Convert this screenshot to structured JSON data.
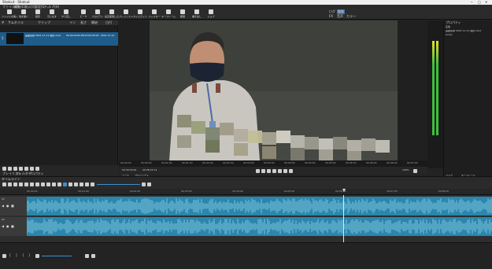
{
  "window": {
    "title": "Shotcut - Shotcut"
  },
  "menu": [
    "ファイル(F)",
    "編集(E)",
    "表示(V)",
    "設定(S)",
    "ヘルプ(H)"
  ],
  "toolbar": [
    {
      "label": "ファイルを開く",
      "icon": "open-folder-icon"
    },
    {
      "label": "他を開く",
      "icon": "open-other-icon"
    },
    {
      "label": "保存",
      "icon": "save-icon"
    },
    {
      "label": "元に戻す",
      "icon": "undo-icon"
    },
    {
      "label": "やり直し",
      "icon": "redo-icon"
    },
    {
      "label": "ピーク",
      "icon": "peak-meter-icon"
    },
    {
      "label": "プロパティ",
      "icon": "properties-icon"
    },
    {
      "label": "最近使用した",
      "icon": "recent-icon"
    },
    {
      "label": "プレイリスト",
      "icon": "playlist-icon"
    },
    {
      "label": "タイムライン",
      "icon": "timeline-icon"
    },
    {
      "label": "フィルター",
      "icon": "filter-icon"
    },
    {
      "label": "キーフレーム",
      "icon": "keyframe-icon"
    },
    {
      "label": "履歴",
      "icon": "history-icon"
    },
    {
      "label": "書き出し",
      "icon": "export-icon"
    },
    {
      "label": "ジョブ",
      "icon": "jobs-icon"
    }
  ],
  "layout_switcher": {
    "items": [
      "ログ",
      "編集",
      "FX",
      "音声",
      "カラー"
    ]
  },
  "playlist": {
    "columns": [
      "#",
      "サムネイル",
      "クリップ",
      "イン",
      "長さ",
      "開始",
      "日付"
    ],
    "row": {
      "index": "1",
      "clip": "画面収録 2021-11-11 撮影.mp4",
      "in": "00:00:00",
      "duration": "00:08:25",
      "start": "00:00:00",
      "date": "2021-11-11"
    },
    "tabs": [
      "プレイリスト",
      "フィルター",
      "プロパティ"
    ]
  },
  "viewer": {
    "timecode": "00:00:00:00",
    "duration": "00:08:25:14",
    "ruler": [
      "00:00:00",
      "00:00:30",
      "00:01:00",
      "00:01:30",
      "00:02:00",
      "00:02:30",
      "00:03:00",
      "00:03:30",
      "00:04:00",
      "00:04:30",
      "00:05:00",
      "00:05:30",
      "00:06:00",
      "00:06:30",
      "00:07:00"
    ],
    "tabs": [
      "ソース",
      "プロジェクト"
    ],
    "zoom": "100%"
  },
  "properties": {
    "title": "プロパティ",
    "lines": [
      "名前",
      "画面収録 2021-11-11 撮影.mp4",
      "Audio"
    ],
    "tabs": [
      "ジョブ",
      "キーフレーム"
    ]
  },
  "timeline": {
    "tabs": [
      "タイムライン"
    ],
    "ruler": [
      "00:00:00",
      "00:01:00",
      "00:02:00",
      "00:03:00",
      "00:04:00",
      "00:05:00",
      "00:06:00",
      "00:07:00",
      "00:08:00"
    ],
    "tracks": [
      {
        "name": "V1"
      },
      {
        "name": "A1"
      }
    ]
  },
  "colors": {
    "clip": "#2a86ad",
    "accent": "#1e5c8a",
    "meter": "#3fbf3f"
  }
}
